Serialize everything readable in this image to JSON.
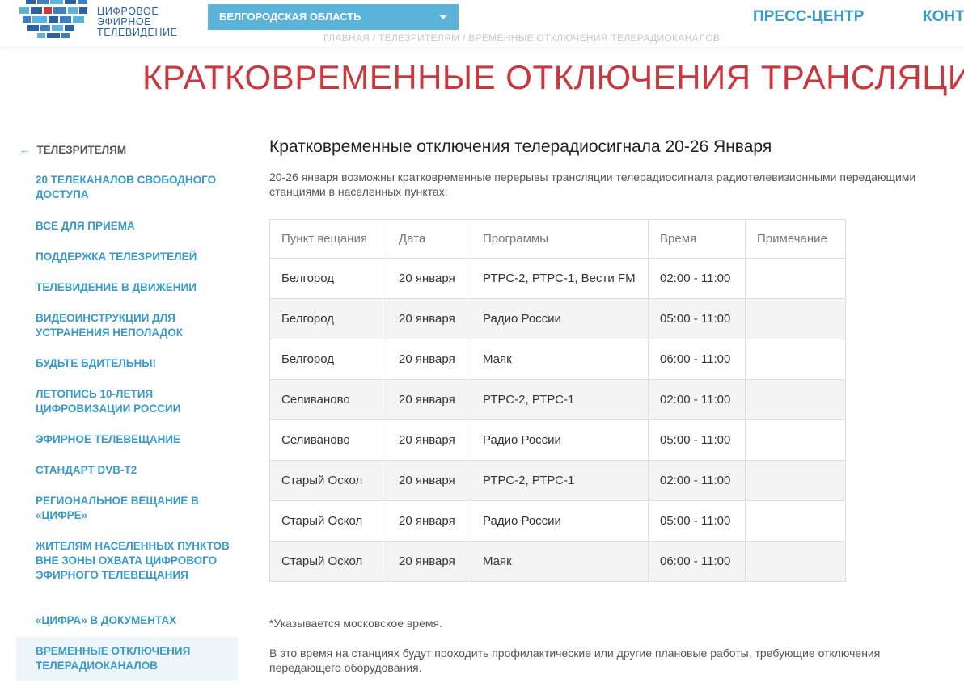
{
  "header": {
    "logo_lines": [
      "ЦИФРОВОЕ",
      "ЭФИРНОЕ",
      "ТЕЛЕВИДЕНИЕ"
    ],
    "region": "БЕЛГОРОДСКАЯ ОБЛАСТЬ",
    "nav": [
      "ПРЕСС-ЦЕНТР",
      "КОНТАКТЫ"
    ],
    "breadcrumb": "ГЛАВНАЯ / ТЕЛЕЗРИТЕЛЯМ / ВРЕМЕННЫЕ ОТКЛЮЧЕНИЯ ТЕЛЕРАДИОКАНАЛОВ"
  },
  "page_title": "КРАТКОВРЕМЕННЫЕ ОТКЛЮЧЕНИЯ ТРАНСЛЯЦИИ",
  "sidebar": {
    "back": "ТЕЛЕЗРИТЕЛЯМ",
    "items": [
      "20 ТЕЛЕКАНАЛОВ СВОБОДНОГО ДОСТУПА",
      "ВСЕ ДЛЯ ПРИЕМА",
      "ПОДДЕРЖКА ТЕЛЕЗРИТЕЛЕЙ",
      "ТЕЛЕВИДЕНИЕ В ДВИЖЕНИИ",
      "ВИДЕОИНСТРУКЦИИ ДЛЯ УСТРАНЕНИЯ НЕПОЛАДОК",
      "БУДЬТЕ БДИТЕЛЬНЫ!",
      "ЛЕТОПИСЬ 10-ЛЕТИЯ ЦИФРОВИЗАЦИИ РОССИИ",
      "ЭФИРНОЕ ТЕЛЕВЕЩАНИЕ",
      "СТАНДАРТ DVB-T2",
      "РЕГИОНАЛЬНОЕ ВЕЩАНИЕ В «ЦИФРЕ»",
      "ЖИТЕЛЯМ НАСЕЛЕННЫХ ПУНКТОВ ВНЕ ЗОНЫ ОХВАТА ЦИФРОВОГО ЭФИРНОГО ТЕЛЕВЕЩАНИЯ",
      "«ЦИФРА» В ДОКУМЕНТАХ",
      "ВРЕМЕННЫЕ ОТКЛЮЧЕНИЯ ТЕЛЕРАДИОКАНАЛОВ"
    ]
  },
  "content": {
    "title": "Кратковременные отключения телерадиосигнала 20-26 Января",
    "intro": "20-26 января возможны кратковременные перерывы трансляции телерадиосигнала радиотелевизионными передающими станциями в населенных пунктах:",
    "table": {
      "headers": [
        "Пункт вещания",
        "Дата",
        "Программы",
        "Время",
        "Примечание"
      ],
      "rows": [
        [
          "Белгород",
          "20 января",
          "РТРС-2, РТРС-1, Вести FM",
          "02:00 - 11:00",
          ""
        ],
        [
          "Белгород",
          "20 января",
          "Радио России",
          "05:00 - 11:00",
          ""
        ],
        [
          "Белгород",
          "20 января",
          "Маяк",
          "06:00 - 11:00",
          ""
        ],
        [
          "Селиваново",
          "20 января",
          "РТРС-2, РТРС-1",
          "02:00 - 11:00",
          ""
        ],
        [
          "Селиваново",
          "20 января",
          "Радио России",
          "05:00 - 11:00",
          ""
        ],
        [
          "Старый Оскол",
          "20 января",
          "РТРС-2, РТРС-1",
          "02:00 - 11:00",
          ""
        ],
        [
          "Старый Оскол",
          "20 января",
          "Радио России",
          "05:00 - 11:00",
          ""
        ],
        [
          "Старый Оскол",
          "20 января",
          "Маяк",
          "06:00 - 11:00",
          ""
        ]
      ]
    },
    "note_time": "*Указывается московское время.",
    "note_works": "В это время на станциях будут проходить профилактические или другие плановые работы, требующие отключения передающего оборудования."
  },
  "colors": {
    "accent_blue": "#3a9ac9",
    "region_bg": "#5bb3d9",
    "title_red": "#c9383e",
    "logo_blue": "#2a62a3"
  }
}
